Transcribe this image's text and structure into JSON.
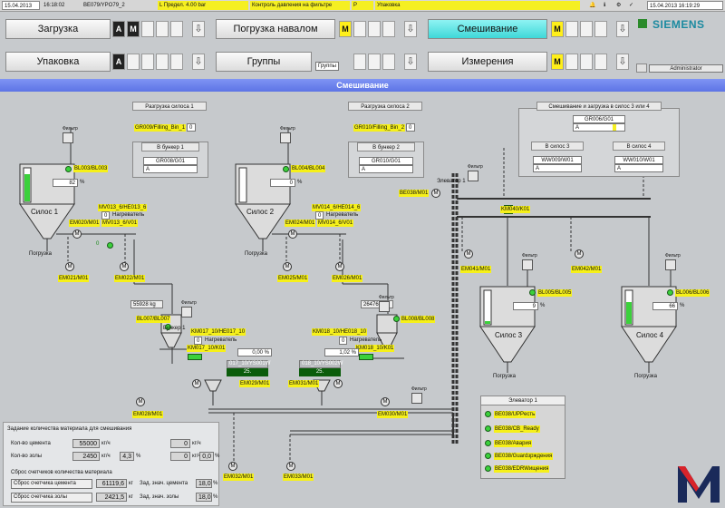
{
  "status": {
    "date": "15.04.2013",
    "time": "16:18:02",
    "code": "BE079/YPO79_2",
    "message": "L Предел. 4.00 bar",
    "alarm": "Контроль давления на фильтре",
    "p": "P",
    "section": "Упаковка",
    "right_datetime": "15.04.2013 16:19:29"
  },
  "nav": [
    {
      "label": "Загрузка",
      "slots": [
        "A",
        "M"
      ]
    },
    {
      "label": "Погрузка навалом",
      "slots": [
        "M"
      ]
    },
    {
      "label": "Смешивание",
      "slots": [
        "M"
      ]
    },
    {
      "label": "Упаковка",
      "slots": [
        "A"
      ]
    },
    {
      "label": "Группы",
      "slots": [],
      "tag": "Группы"
    },
    {
      "label": "Измерения",
      "slots": [
        "M"
      ]
    }
  ],
  "brand": "SIEMENS",
  "user": "Administrator",
  "title": "Смешивание",
  "silo1": {
    "header": "Разгрузка силоса 1",
    "filling": "GR009/Filling_Bin_1",
    "filling_val": "0",
    "bunker_title": "В бункер 1",
    "gr": "GR008/G01",
    "gr_val": "A",
    "sensor": "BL003/BL003",
    "pct": "82",
    "pct_unit": "%",
    "name": "Силос 1",
    "unload": "Погрузка",
    "mv": "MV013_6/HE013_6",
    "mv_val": "0",
    "heat": "Нагреватель",
    "mv2": "MV013_6/V01",
    "em1": "EM020/M01",
    "em2": "EM021/M01",
    "em3": "EM022/M01",
    "v": "0"
  },
  "silo2": {
    "header": "Разгрузка силоса 2",
    "filling": "GR010/Filling_Bin_2",
    "filling_val": "0",
    "bunker_title": "В бункер 2",
    "gr": "GR010/G01",
    "gr_val": "A",
    "sensor": "BL004/BL004",
    "pct": "0",
    "pct_unit": "%",
    "name": "Силос 2",
    "unload": "Погрузка",
    "mv": "MV014_6/HE014_6",
    "mv_val": "0",
    "heat": "Нагреватель",
    "mv2": "MV014_6/V01",
    "em1": "EM024/M01",
    "em2": "EM025/M01",
    "em3": "EM026/M01"
  },
  "loading34": {
    "header": "Смешивание и загрузка в силос 3 или 4",
    "gr": "GR006/G01",
    "gr_val": "A",
    "silo3_title": "В силос 3",
    "silo3_gr": "WW009/W01",
    "silo3_val": "A",
    "silo4_title": "В силос 4",
    "silo4_gr": "WW010/W01",
    "silo4_val": "A"
  },
  "elevator": {
    "label": "Элеватор 1",
    "be": "BE038/M01",
    "km": "KM040/K01",
    "em41": "EM041/M01",
    "em42": "EM042/M01"
  },
  "silo3": {
    "sensor": "BL005/BL005",
    "pct": "9",
    "unit": "%",
    "name": "Силос 3",
    "unload": "Погрузка"
  },
  "silo4": {
    "sensor": "BL006/BL006",
    "pct": "66",
    "unit": "%",
    "name": "Силос 4",
    "unload": "Погрузка"
  },
  "bunker1": {
    "weight": "55928 kg",
    "sensor": "BL007/BL007",
    "name": "Бункер 1",
    "km": "KM017_10/HE017_10",
    "km_val": "0",
    "heat": "Нагреватель",
    "km2": "KM017_10/K01",
    "pct": "0,00 %",
    "ys": "017_10/YS001W",
    "ys_val": "25.",
    "em28": "EM028/M01",
    "em29": "EM029/M01",
    "em32": "EM032/M01"
  },
  "bunker2": {
    "weight": "26476 kg",
    "sensor": "BL008/BL008",
    "km": "KM018_10/HE018_10",
    "km_val": "0",
    "heat": "Нагреватель",
    "km2": "KM018_10/K01",
    "pct": "1,02 %",
    "ys": "018_10/YS002W",
    "ys_val": "25.",
    "em31": "EM031/M01",
    "em30": "EM030/M01",
    "em33": "EM033/M01"
  },
  "filter": "Фильтр",
  "request": {
    "title": "Задание количества материала для смешивания",
    "cement_lbl": "Кол-во цемента",
    "cement": "55000",
    "cement_u": "кг/ч",
    "cement2": "0",
    "cement2_u": "кг/ч",
    "ash_lbl": "Кол-во золы",
    "ash": "2450",
    "ash_u": "кг/ч",
    "ash_pct": "4,3",
    "ash2": "0",
    "ash2_u": "кг/ч",
    "ash2_pct": "0,0",
    "pct": "%",
    "reset_title": "Сброс счетчиков количества материала",
    "reset_cement": "Сброс счетчика цемента",
    "cement_total": "61119,6",
    "kg": "кг",
    "reset_ash": "Сброс счетчика золы",
    "ash_total": "2421,5",
    "pct_lbl_c": "Зад. знач. цемента",
    "pct_c": "18,0",
    "pct_lbl_a": "Зад. знач. золы",
    "pct_a": "18,0"
  },
  "elev_panel": {
    "title": "Элеватор 1",
    "items": [
      "BE038/UPPесть",
      "BE038/CB_Ready",
      "BE038/Авария",
      "BE038/Guardзрждения",
      "BE038/EDRWищения"
    ]
  },
  "colors": {
    "accent": "#5d74e6",
    "yellow": "#f5ef22",
    "green": "#3bd13b",
    "cyan": "#3fd8d8"
  }
}
